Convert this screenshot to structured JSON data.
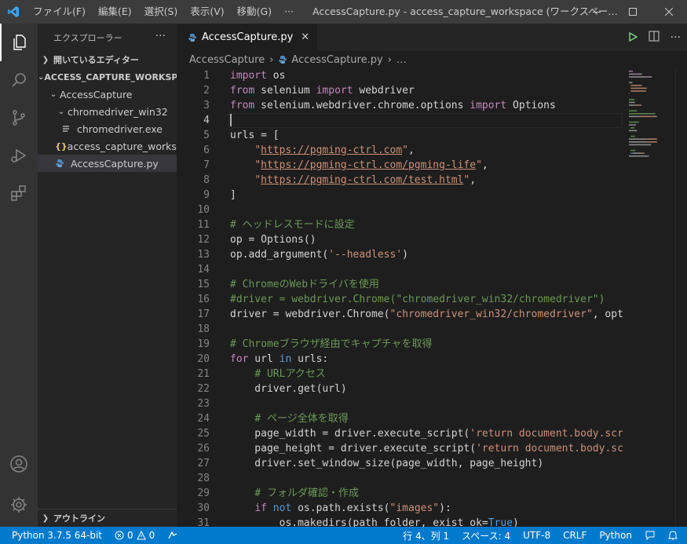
{
  "titlebar": {
    "menus": [
      "ファイル(F)",
      "編集(E)",
      "選択(S)",
      "表示(V)",
      "移動(G)",
      "···"
    ],
    "title": "AccessCapture.py - access_capture_workspace (ワークスペー…"
  },
  "sidebar": {
    "header": "エクスプローラー",
    "open_editors": "開いているエディター",
    "workspace": "ACCESS_CAPTURE_WORKSP...",
    "tree": [
      {
        "label": "AccessCapture",
        "kind": "folder"
      },
      {
        "label": "chromedriver_win32",
        "kind": "folder"
      },
      {
        "label": "chromedriver.exe",
        "kind": "file"
      },
      {
        "label": "access_capture_works...",
        "kind": "json"
      },
      {
        "label": "AccessCapture.py",
        "kind": "python"
      }
    ],
    "outline": "アウトライン"
  },
  "editor": {
    "tab": "AccessCapture.py",
    "breadcrumb": [
      "AccessCapture",
      "AccessCapture.py",
      "…"
    ]
  },
  "code": [
    [
      [
        "kw",
        "import"
      ],
      [
        "t",
        " os"
      ]
    ],
    [
      [
        "kw",
        "from"
      ],
      [
        "t",
        " selenium "
      ],
      [
        "kw",
        "import"
      ],
      [
        "t",
        " webdriver"
      ]
    ],
    [
      [
        "kw",
        "from"
      ],
      [
        "t",
        " selenium.webdriver.chrome.options "
      ],
      [
        "kw",
        "import"
      ],
      [
        "t",
        " Options"
      ]
    ],
    [],
    [
      [
        "t",
        "urls = ["
      ]
    ],
    [
      [
        "t",
        "    "
      ],
      [
        "str",
        "\""
      ],
      [
        "link",
        "https://pgming-ctrl.com"
      ],
      [
        "str",
        "\""
      ],
      [
        "t",
        ","
      ]
    ],
    [
      [
        "t",
        "    "
      ],
      [
        "str",
        "\""
      ],
      [
        "link",
        "https://pgming-ctrl.com/pgming-life"
      ],
      [
        "str",
        "\""
      ],
      [
        "t",
        ","
      ]
    ],
    [
      [
        "t",
        "    "
      ],
      [
        "str",
        "\""
      ],
      [
        "link",
        "https://pgming-ctrl.com/test.html"
      ],
      [
        "str",
        "\""
      ],
      [
        "t",
        ","
      ]
    ],
    [
      [
        "t",
        "]"
      ]
    ],
    [],
    [
      [
        "cm",
        "# ヘッドレスモードに設定"
      ]
    ],
    [
      [
        "t",
        "op = Options()"
      ]
    ],
    [
      [
        "t",
        "op.add_argument("
      ],
      [
        "str",
        "'--headless'"
      ],
      [
        "t",
        ")"
      ]
    ],
    [],
    [
      [
        "cm",
        "# ChromeのWebドライバを使用"
      ]
    ],
    [
      [
        "cm",
        "#driver = webdriver.Chrome(\"chromedriver_win32/chromedriver\")"
      ]
    ],
    [
      [
        "t",
        "driver = webdriver.Chrome("
      ],
      [
        "str",
        "\"chromedriver_win32/chromedriver\""
      ],
      [
        "t",
        ", opti"
      ]
    ],
    [],
    [
      [
        "cm",
        "# Chromeブラウザ経由でキャプチャを取得"
      ]
    ],
    [
      [
        "kw",
        "for"
      ],
      [
        "t",
        " url "
      ],
      [
        "kw2",
        "in"
      ],
      [
        "t",
        " urls:"
      ]
    ],
    [
      [
        "t",
        "    "
      ],
      [
        "cm",
        "# URLアクセス"
      ]
    ],
    [
      [
        "t",
        "    driver.get(url)"
      ]
    ],
    [],
    [
      [
        "t",
        "    "
      ],
      [
        "cm",
        "# ページ全体を取得"
      ]
    ],
    [
      [
        "t",
        "    page_width = driver.execute_script("
      ],
      [
        "str",
        "'return document.body.scro"
      ]
    ],
    [
      [
        "t",
        "    page_height = driver.execute_script("
      ],
      [
        "str",
        "'return document.body.scr"
      ]
    ],
    [
      [
        "t",
        "    driver.set_window_size(page_width, page_height)"
      ]
    ],
    [],
    [
      [
        "t",
        "    "
      ],
      [
        "cm",
        "# フォルダ確認・作成"
      ]
    ],
    [
      [
        "t",
        "    "
      ],
      [
        "kw",
        "if"
      ],
      [
        "t",
        " "
      ],
      [
        "kw2",
        "not"
      ],
      [
        "t",
        " os.path.exists("
      ],
      [
        "str",
        "\"images\""
      ],
      [
        "t",
        "):"
      ]
    ],
    [
      [
        "t",
        "        os.makedirs(path_folder, exist_ok="
      ],
      [
        "kw2",
        "True"
      ],
      [
        "t",
        ")"
      ]
    ]
  ],
  "statusbar": {
    "python": "Python 3.7.5 64-bit",
    "errors": "0",
    "warnings": "0",
    "position": "行 4、列 1",
    "spaces": "スペース: 4",
    "encoding": "UTF-8",
    "eol": "CRLF",
    "language": "Python"
  },
  "colors": {
    "accent": "#007acc",
    "activity": "#333333",
    "sidebar": "#252526",
    "editor": "#1e1e1e"
  }
}
